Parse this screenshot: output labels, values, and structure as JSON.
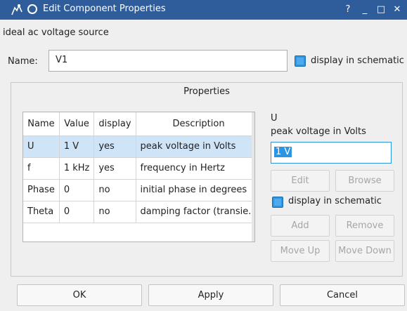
{
  "window": {
    "title": "Edit Component Properties",
    "buttons": {
      "help": "?",
      "minimize": "_",
      "maximize": "□",
      "close": "✕"
    }
  },
  "component_description": "ideal ac voltage source",
  "name": {
    "label": "Name:",
    "value": "V1"
  },
  "display_in_schematic": {
    "label": "display in schematic",
    "checked": true
  },
  "properties": {
    "group_title": "Properties",
    "columns": [
      "Name",
      "Value",
      "display",
      "Description"
    ],
    "rows": [
      {
        "name": "U",
        "value": "1 V",
        "display": "yes",
        "description": "peak voltage in Volts",
        "selected": true
      },
      {
        "name": "f",
        "value": "1 kHz",
        "display": "yes",
        "description": "frequency in Hertz",
        "selected": false
      },
      {
        "name": "Phase",
        "value": "0",
        "display": "no",
        "description": "initial phase in degrees",
        "selected": false
      },
      {
        "name": "Theta",
        "value": "0",
        "display": "no",
        "description": "damping factor (transie...",
        "selected": false
      }
    ]
  },
  "selected_property": {
    "name": "U",
    "description": "peak voltage in Volts",
    "value": "1 V",
    "display_label": "display in schematic",
    "display_checked": true
  },
  "property_buttons": {
    "edit": "Edit",
    "browse": "Browse",
    "add": "Add",
    "remove": "Remove",
    "move_up": "Move Up",
    "move_down": "Move Down"
  },
  "dialog_buttons": {
    "ok": "OK",
    "apply": "Apply",
    "cancel": "Cancel"
  },
  "colors": {
    "titlebar": "#2f5c9a",
    "accent": "#2d95e0",
    "selection": "#cfe4f7"
  }
}
